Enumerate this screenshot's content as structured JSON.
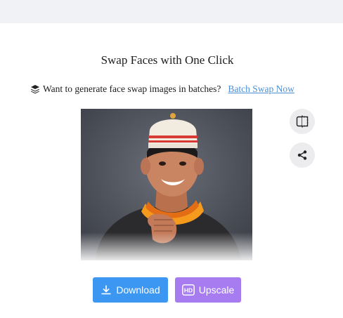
{
  "header": {
    "title": "Swap Faces with One Click"
  },
  "promo": {
    "icon": "layers-icon",
    "text": "Want to generate face swap images in batches?",
    "link_label": "Batch Swap Now",
    "link_color": "#4d8fd6"
  },
  "side_actions": {
    "compare_icon": "compare-icon",
    "share_icon": "share-icon"
  },
  "actions": {
    "download_label": "Download",
    "upscale_label": "Upscale",
    "hd_badge": "HD",
    "download_color": "#3c97f3",
    "upscale_color": "#a77cf0"
  }
}
